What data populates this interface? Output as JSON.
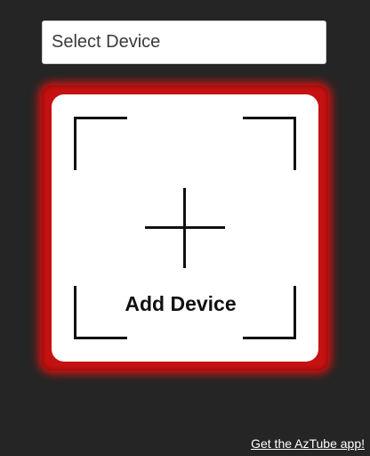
{
  "device_select": {
    "placeholder": "Select Device"
  },
  "add_device": {
    "label": "Add Device",
    "highlight_color": "#c41212"
  },
  "footer": {
    "app_link": "Get the AzTube app!"
  },
  "colors": {
    "background": "#252525",
    "card": "#ffffff",
    "ink": "#111111"
  }
}
